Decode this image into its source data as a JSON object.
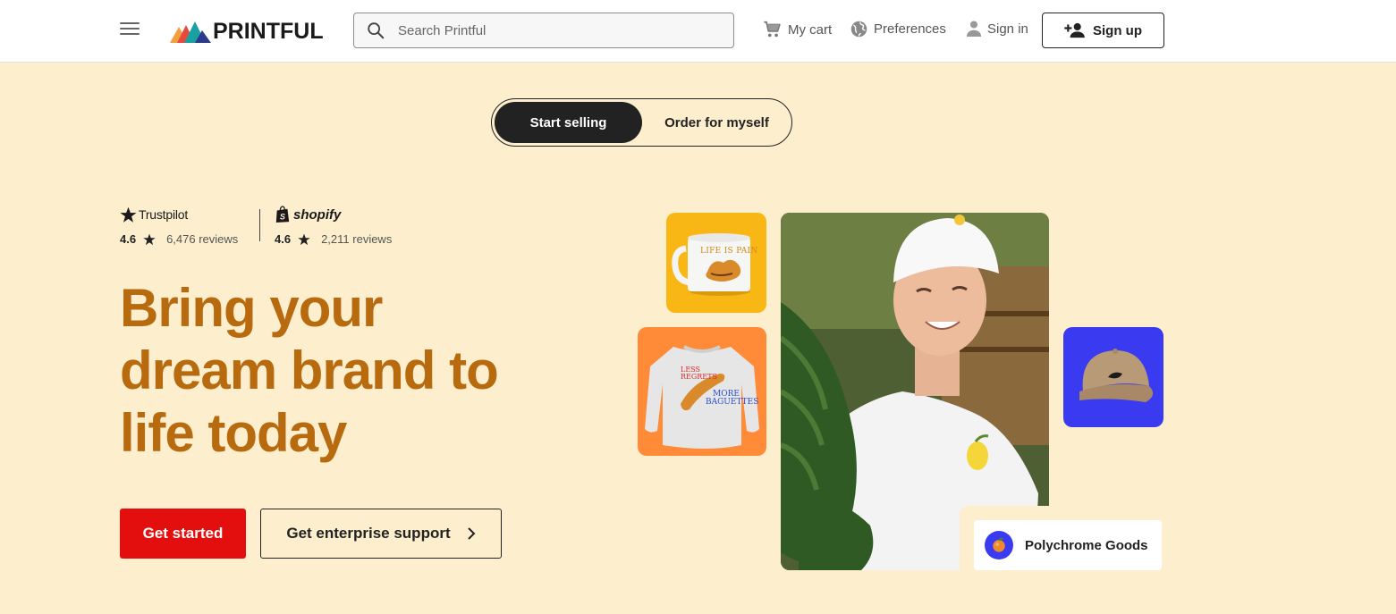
{
  "header": {
    "logo_text": "PRINTFUL",
    "search_placeholder": "Search Printful",
    "cart_label": "My cart",
    "preferences_label": "Preferences",
    "signin_label": "Sign in",
    "signup_label": "Sign up",
    "icons": [
      "menu-icon",
      "search-icon",
      "cart-icon",
      "globe-icon",
      "person-icon",
      "add-person-icon"
    ]
  },
  "toggle": {
    "selected": "Start selling",
    "options": [
      "Start selling",
      "Order for myself"
    ]
  },
  "reviews": [
    {
      "brand": "Trustpilot",
      "score": "4.6",
      "count": "6,476 reviews"
    },
    {
      "brand": "shopify",
      "score": "4.6",
      "count": "2,211 reviews"
    }
  ],
  "hero": {
    "headline_lines": [
      "Bring your",
      "dream brand to",
      "life today"
    ],
    "primary_cta": "Get started",
    "secondary_cta": "Get enterprise support",
    "brand_card_name": "Polychrome Goods"
  },
  "product_tiles": {
    "mug_text": "LIFE IS PAIN",
    "sweatshirt_text_top": "LESS REGRETS",
    "sweatshirt_text_bottom": "MORE BAGUETTES"
  },
  "colors": {
    "background": "#fdefcd",
    "headline": "#b86a0f",
    "primary_button": "#e30f0f",
    "dark": "#222222",
    "mug_tile": "#f9b716",
    "sweatshirt_tile": "#ff8a37",
    "cap_tile": "#3a3af0"
  }
}
